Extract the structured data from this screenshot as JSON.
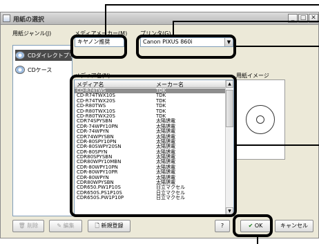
{
  "window": {
    "title": "用紙の選択"
  },
  "left": {
    "label": "用紙ジャンル(J)",
    "items": [
      {
        "label": "CDダイレクトプリント"
      },
      {
        "label": "CDケース"
      }
    ]
  },
  "media_maker": {
    "label": "メディアメーカー(M)",
    "value": "キヤノン推奨"
  },
  "printer": {
    "label": "プリンタ(G)",
    "value": "Canon PIXUS 860i"
  },
  "media_list": {
    "label": "メディア名(N)",
    "col_name": "メディア名",
    "col_maker": "メーカー名",
    "rows": [
      {
        "name": "CD-R74TWS",
        "maker": "TDK"
      },
      {
        "name": "CD-R74TWX10S",
        "maker": "TDK"
      },
      {
        "name": "CD-R74TWX20S",
        "maker": "TDK"
      },
      {
        "name": "CD-R80TWS",
        "maker": "TDK"
      },
      {
        "name": "CD-R80TWX10S",
        "maker": "TDK"
      },
      {
        "name": "CD-R80TWX20S",
        "maker": "TDK"
      },
      {
        "name": "CDR74SPYSBN",
        "maker": "太陽誘電"
      },
      {
        "name": "CDR-74WPY10PN",
        "maker": "太陽誘電"
      },
      {
        "name": "CDR-74WPYN",
        "maker": "太陽誘電"
      },
      {
        "name": "CDR74WPYSBN",
        "maker": "太陽誘電"
      },
      {
        "name": "CDR-80SPY10PN",
        "maker": "太陽誘電"
      },
      {
        "name": "CDR-80SWPY20SN",
        "maker": "太陽誘電"
      },
      {
        "name": "CDR-80SPYN",
        "maker": "太陽誘電"
      },
      {
        "name": "CDR80SPYSBN",
        "maker": "太陽誘電"
      },
      {
        "name": "CDR80WPY10MBN",
        "maker": "太陽誘電"
      },
      {
        "name": "CDR-80WPY10PN",
        "maker": "太陽誘電"
      },
      {
        "name": "CDR-80WPY10PR",
        "maker": "太陽誘電"
      },
      {
        "name": "CDR-80WPYN",
        "maker": "太陽誘電"
      },
      {
        "name": "CDR80WPYSBN",
        "maker": "太陽誘電"
      },
      {
        "name": "CDR650.PW1P10S",
        "maker": "日立マクセル"
      },
      {
        "name": "CDR650S.PS1P10S",
        "maker": "日立マクセル"
      },
      {
        "name": "CDR650S.PW1P10P",
        "maker": "日立マクセル"
      }
    ]
  },
  "preview": {
    "label": "用紙イメージ"
  },
  "buttons": {
    "delete": "削除",
    "edit": "編集",
    "new": "新規登録",
    "help": "?",
    "ok": "OK",
    "cancel": "キャンセル"
  }
}
